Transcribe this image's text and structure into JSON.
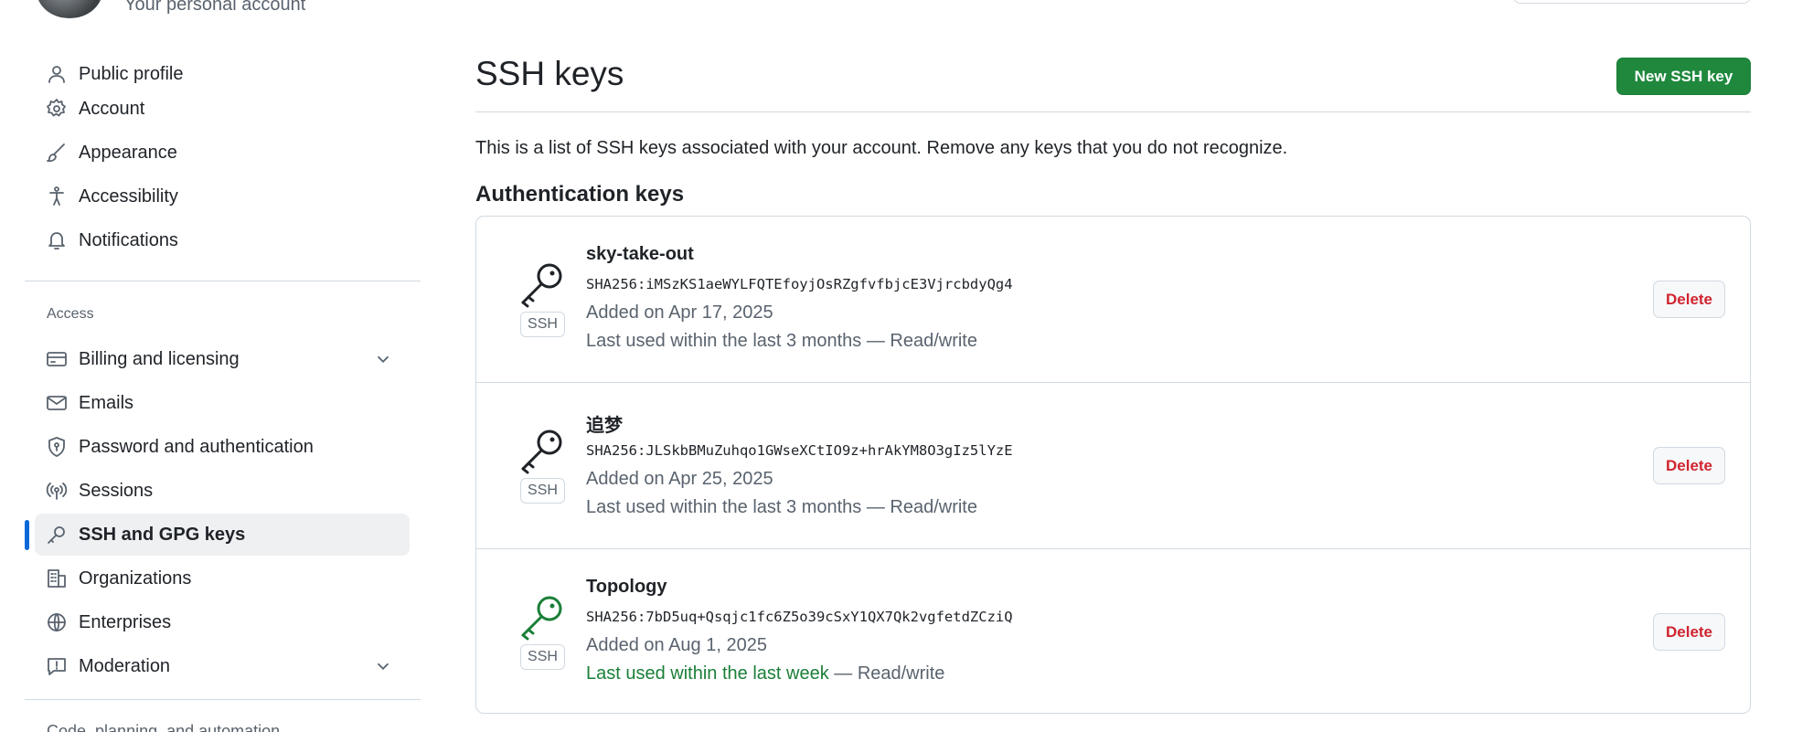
{
  "header": {
    "account_subtitle": "Your personal account"
  },
  "sidebar": {
    "items": [
      {
        "label": "Public profile"
      },
      {
        "label": "Account"
      },
      {
        "label": "Appearance"
      },
      {
        "label": "Accessibility"
      },
      {
        "label": "Notifications"
      }
    ],
    "access_title": "Access",
    "access_items": [
      {
        "label": "Billing and licensing"
      },
      {
        "label": "Emails"
      },
      {
        "label": "Password and authentication"
      },
      {
        "label": "Sessions"
      },
      {
        "label": "SSH and GPG keys"
      },
      {
        "label": "Organizations"
      },
      {
        "label": "Enterprises"
      },
      {
        "label": "Moderation"
      }
    ],
    "next_section_title": "Code, planning, and automation"
  },
  "main": {
    "title": "SSH keys",
    "new_key_label": "New SSH key",
    "description": "This is a list of SSH keys associated with your account. Remove any keys that you do not recognize.",
    "subheading": "Authentication keys",
    "keys": [
      {
        "name": "sky-take-out",
        "fingerprint": "SHA256:iMSzKS1aeWYLFQTEfoyjOsRZgfvfbjcE3VjrcbdyQg4",
        "added": "Added on Apr 17, 2025",
        "used_prefix": "",
        "used_main": "Last used within the last 3 months",
        "used_suffix": " — Read/write",
        "type_label": "SSH",
        "delete_label": "Delete",
        "icon_color": "#1f2328"
      },
      {
        "name": "追梦",
        "fingerprint": "SHA256:JLSkbBMuZuhqo1GWseXCtIO9z+hrAkYM8O3gIz5lYzE",
        "added": "Added on Apr 25, 2025",
        "used_prefix": "",
        "used_main": "Last used within the last 3 months",
        "used_suffix": " — Read/write",
        "type_label": "SSH",
        "delete_label": "Delete",
        "icon_color": "#1f2328"
      },
      {
        "name": "Topology",
        "fingerprint": "SHA256:7bD5uq+Qsqjc1fc6Z5o39cSxY1QX7Qk2vgfetdZCziQ",
        "added": "Added on Aug 1, 2025",
        "used_prefix": "Last used within the last week",
        "used_main": "",
        "used_suffix": " — Read/write",
        "type_label": "SSH",
        "delete_label": "Delete",
        "icon_color": "#1a7f37"
      }
    ]
  },
  "colors": {
    "accent": "#0969da",
    "primary_button": "#1f883d",
    "danger": "#d1242f",
    "success_text": "#1a7f37"
  }
}
